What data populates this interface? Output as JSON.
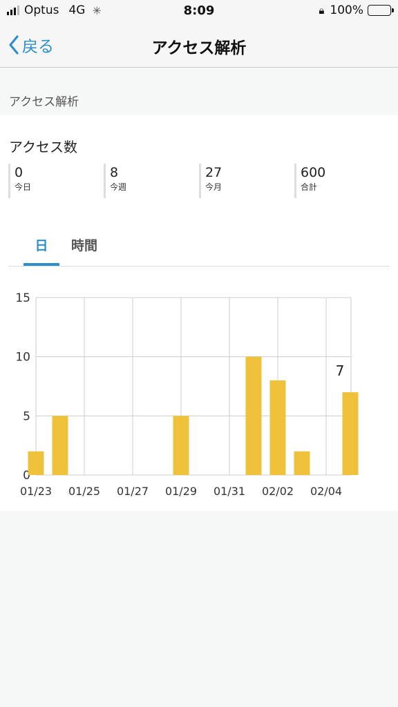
{
  "status_bar": {
    "carrier": "Optus",
    "network": "4G",
    "time": "8:09",
    "battery_percent": "100%",
    "signal_bars": 3
  },
  "nav": {
    "back_label": "戻る",
    "title": "アクセス解析"
  },
  "section": {
    "header": "アクセス解析"
  },
  "card": {
    "title": "アクセス数",
    "stats": [
      {
        "value": "0",
        "label": "今日"
      },
      {
        "value": "8",
        "label": "今週"
      },
      {
        "value": "27",
        "label": "今月"
      },
      {
        "value": "600",
        "label": "合計"
      }
    ],
    "tabs": [
      {
        "label": "日",
        "active": true
      },
      {
        "label": "時間",
        "active": false
      }
    ]
  },
  "colors": {
    "accent": "#2c8fc9",
    "bar": "#f0c23b",
    "grid": "#cccccc"
  },
  "chart_data": {
    "type": "bar",
    "categories": [
      "01/23",
      "01/24",
      "01/25",
      "01/26",
      "01/27",
      "01/28",
      "01/29",
      "01/30",
      "01/31",
      "02/01",
      "02/02",
      "02/03",
      "02/04",
      "02/05"
    ],
    "values": [
      2,
      5,
      0,
      0,
      0,
      0,
      5,
      0,
      0,
      10,
      8,
      2,
      0,
      7
    ],
    "x_tick_labels": [
      "01/23",
      "01/25",
      "01/27",
      "01/29",
      "01/31",
      "02/02",
      "02/04"
    ],
    "y_ticks": [
      0,
      5,
      10,
      15
    ],
    "ylim": [
      0,
      15
    ],
    "annotation": {
      "category": "02/05",
      "text": "7"
    },
    "grid": true
  }
}
